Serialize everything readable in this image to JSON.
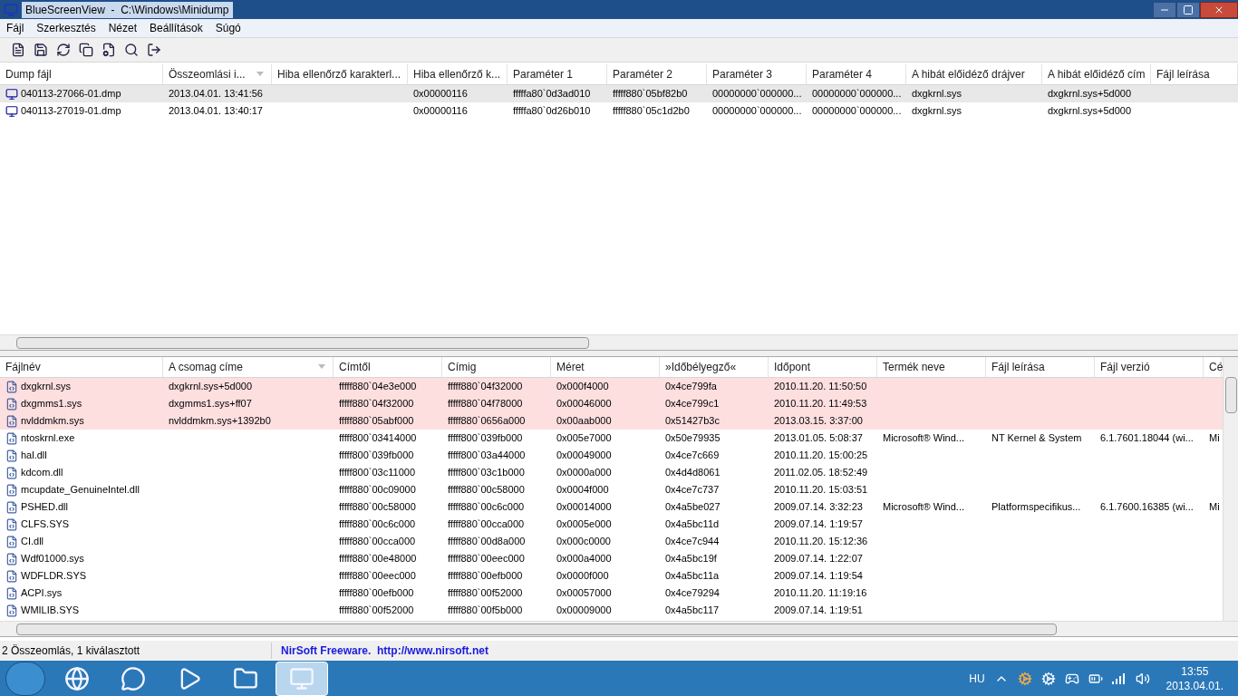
{
  "window": {
    "title": "BlueScreenView  -  C:\\Windows\\Minidump"
  },
  "menu": [
    "Fájl",
    "Szerkesztés",
    "Nézet",
    "Beállítások",
    "Súgó"
  ],
  "crash_list": {
    "columns": [
      {
        "label": "Dump fájl",
        "sorted": false
      },
      {
        "label": "Összeomlási i...",
        "sorted": true
      },
      {
        "label": "Hiba ellenőrző karakterl...",
        "sorted": false
      },
      {
        "label": "Hiba ellenőrző k...",
        "sorted": false
      },
      {
        "label": "Paraméter 1",
        "sorted": false
      },
      {
        "label": "Paraméter 2",
        "sorted": false
      },
      {
        "label": "Paraméter 3",
        "sorted": false
      },
      {
        "label": "Paraméter 4",
        "sorted": false
      },
      {
        "label": "A hibát előidéző drájver",
        "sorted": false
      },
      {
        "label": "A hibát előidéző cím",
        "sorted": false
      },
      {
        "label": "Fájl leírása",
        "sorted": false
      }
    ],
    "rows": [
      {
        "selected": true,
        "cells": [
          "040113-27066-01.dmp",
          "2013.04.01. 13:41:56",
          null,
          "0x00000116",
          "fffffa80`0d3ad010",
          "fffff880`05bf82b0",
          "00000000`000000...",
          "00000000`000000...",
          "dxgkrnl.sys",
          "dxgkrnl.sys+5d000",
          null
        ]
      },
      {
        "selected": false,
        "cells": [
          "040113-27019-01.dmp",
          "2013.04.01. 13:40:17",
          null,
          "0x00000116",
          "fffffa80`0d26b010",
          "fffff880`05c1d2b0",
          "00000000`000000...",
          "00000000`000000...",
          "dxgkrnl.sys",
          "dxgkrnl.sys+5d000",
          null
        ]
      }
    ]
  },
  "module_list": {
    "columns": [
      {
        "label": "Fájlnév",
        "sorted": false
      },
      {
        "label": "A csomag címe",
        "sorted": true
      },
      {
        "label": "Címtől",
        "sorted": false
      },
      {
        "label": "Címig",
        "sorted": false
      },
      {
        "label": "Méret",
        "sorted": false
      },
      {
        "label": "»Időbélyegző«",
        "sorted": false
      },
      {
        "label": "Időpont",
        "sorted": false
      },
      {
        "label": "Termék neve",
        "sorted": false
      },
      {
        "label": "Fájl leírása",
        "sorted": false
      },
      {
        "label": "Fájl verzió",
        "sorted": false
      },
      {
        "label": "Cé",
        "sorted": false
      }
    ],
    "rows": [
      {
        "highlighted": true,
        "cells": [
          "dxgkrnl.sys",
          "dxgkrnl.sys+5d000",
          "fffff880`04e3e000",
          "fffff880`04f32000",
          "0x000f4000",
          "0x4ce799fa",
          "2010.11.20. 11:50:50",
          null,
          null,
          null,
          null
        ]
      },
      {
        "highlighted": true,
        "cells": [
          "dxgmms1.sys",
          "dxgmms1.sys+ff07",
          "fffff880`04f32000",
          "fffff880`04f78000",
          "0x00046000",
          "0x4ce799c1",
          "2010.11.20. 11:49:53",
          null,
          null,
          null,
          null
        ]
      },
      {
        "highlighted": true,
        "cells": [
          "nvlddmkm.sys",
          "nvlddmkm.sys+1392b0",
          "fffff880`05abf000",
          "fffff880`0656a000",
          "0x00aab000",
          "0x51427b3c",
          "2013.03.15. 3:37:00",
          null,
          null,
          null,
          null
        ]
      },
      {
        "highlighted": false,
        "cells": [
          "ntoskrnl.exe",
          null,
          "fffff800`03414000",
          "fffff800`039fb000",
          "0x005e7000",
          "0x50e79935",
          "2013.01.05. 5:08:37",
          "Microsoft® Wind...",
          "NT Kernel & System",
          "6.1.7601.18044 (wi...",
          "Mi"
        ]
      },
      {
        "highlighted": false,
        "cells": [
          "hal.dll",
          null,
          "fffff800`039fb000",
          "fffff800`03a44000",
          "0x00049000",
          "0x4ce7c669",
          "2010.11.20. 15:00:25",
          null,
          null,
          null,
          null
        ]
      },
      {
        "highlighted": false,
        "cells": [
          "kdcom.dll",
          null,
          "fffff800`03c11000",
          "fffff800`03c1b000",
          "0x0000a000",
          "0x4d4d8061",
          "2011.02.05. 18:52:49",
          null,
          null,
          null,
          null
        ]
      },
      {
        "highlighted": false,
        "cells": [
          "mcupdate_GenuineIntel.dll",
          null,
          "fffff880`00c09000",
          "fffff880`00c58000",
          "0x0004f000",
          "0x4ce7c737",
          "2010.11.20. 15:03:51",
          null,
          null,
          null,
          null
        ]
      },
      {
        "highlighted": false,
        "cells": [
          "PSHED.dll",
          null,
          "fffff880`00c58000",
          "fffff880`00c6c000",
          "0x00014000",
          "0x4a5be027",
          "2009.07.14. 3:32:23",
          "Microsoft® Wind...",
          "Platformspecifikus...",
          "6.1.7600.16385 (wi...",
          "Mi"
        ]
      },
      {
        "highlighted": false,
        "cells": [
          "CLFS.SYS",
          null,
          "fffff880`00c6c000",
          "fffff880`00cca000",
          "0x0005e000",
          "0x4a5bc11d",
          "2009.07.14. 1:19:57",
          null,
          null,
          null,
          null
        ]
      },
      {
        "highlighted": false,
        "cells": [
          "CI.dll",
          null,
          "fffff880`00cca000",
          "fffff880`00d8a000",
          "0x000c0000",
          "0x4ce7c944",
          "2010.11.20. 15:12:36",
          null,
          null,
          null,
          null
        ]
      },
      {
        "highlighted": false,
        "cells": [
          "Wdf01000.sys",
          null,
          "fffff880`00e48000",
          "fffff880`00eec000",
          "0x000a4000",
          "0x4a5bc19f",
          "2009.07.14. 1:22:07",
          null,
          null,
          null,
          null
        ]
      },
      {
        "highlighted": false,
        "cells": [
          "WDFLDR.SYS",
          null,
          "fffff880`00eec000",
          "fffff880`00efb000",
          "0x0000f000",
          "0x4a5bc11a",
          "2009.07.14. 1:19:54",
          null,
          null,
          null,
          null
        ]
      },
      {
        "highlighted": false,
        "cells": [
          "ACPI.sys",
          null,
          "fffff880`00efb000",
          "fffff880`00f52000",
          "0x00057000",
          "0x4ce79294",
          "2010.11.20. 11:19:16",
          null,
          null,
          null,
          null
        ]
      },
      {
        "highlighted": false,
        "cells": [
          "WMILIB.SYS",
          null,
          "fffff880`00f52000",
          "fffff880`00f5b000",
          "0x00009000",
          "0x4a5bc117",
          "2009.07.14. 1:19:51",
          null,
          null,
          null,
          null
        ]
      }
    ]
  },
  "status_bar": {
    "summary": "2 Összeomlás, 1 kiválasztott",
    "credit": "NirSoft Freeware.  http://www.nirsoft.net"
  },
  "taskbar": {
    "apps": [
      {
        "kind": "browser",
        "selected": false
      },
      {
        "kind": "chat",
        "selected": false
      },
      {
        "kind": "studio",
        "selected": false
      },
      {
        "kind": "folder",
        "selected": false
      },
      {
        "kind": "monitor",
        "selected": true
      }
    ],
    "language": "HU",
    "time": "13:55",
    "date": "2013.04.01."
  }
}
